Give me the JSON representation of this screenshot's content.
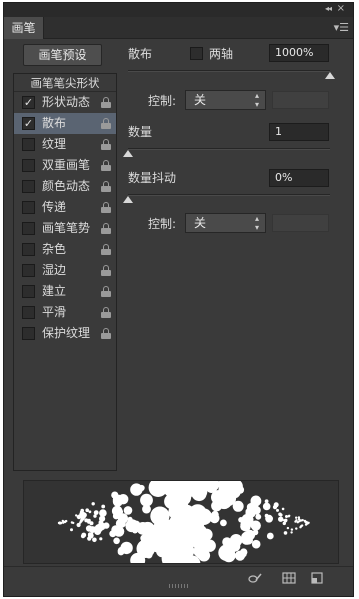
{
  "panel": {
    "tab_label": "画笔",
    "preset_button": "画笔预设",
    "list_header": "画笔笔尖形状",
    "items": [
      {
        "label": "形状动态",
        "checked": true,
        "selected": false
      },
      {
        "label": "散布",
        "checked": true,
        "selected": true
      },
      {
        "label": "纹理",
        "checked": false,
        "selected": false
      },
      {
        "label": "双重画笔",
        "checked": false,
        "selected": false
      },
      {
        "label": "颜色动态",
        "checked": false,
        "selected": false
      },
      {
        "label": "传递",
        "checked": false,
        "selected": false
      },
      {
        "label": "画笔笔势",
        "checked": false,
        "selected": false
      },
      {
        "label": "杂色",
        "checked": false,
        "selected": false
      },
      {
        "label": "湿边",
        "checked": false,
        "selected": false
      },
      {
        "label": "建立",
        "checked": false,
        "selected": false
      },
      {
        "label": "平滑",
        "checked": false,
        "selected": false
      },
      {
        "label": "保护纹理",
        "checked": false,
        "selected": false
      }
    ]
  },
  "scatter": {
    "label": "散布",
    "both_axes_label": "两轴",
    "value": "1000%",
    "level": 1.0,
    "control_label": "控制:",
    "control_value": "关"
  },
  "count": {
    "label": "数量",
    "value": "1",
    "level": 0.0
  },
  "count_jitter": {
    "label": "数量抖动",
    "value": "0%",
    "level": 0.0,
    "control_label": "控制:",
    "control_value": "关"
  },
  "icons": {
    "collapse": "collapse-icon",
    "close": "close-icon",
    "menu": "panel-menu-icon",
    "check": "check-icon",
    "lock": "lock-icon",
    "toggle_preview": "toggle-preview-icon",
    "grid": "grid-icon",
    "new_preset": "new-preset-icon"
  },
  "glyphs": {
    "collapse": "◂◂",
    "close": "×",
    "menu": "▾☰",
    "check": "✓",
    "select_arrows": "▴▾"
  },
  "colors": {
    "panel_bg": "#3a3a3a",
    "selected_row": "#5a6472",
    "field_bg": "#2a2a2a",
    "accent_white": "#ffffff"
  }
}
